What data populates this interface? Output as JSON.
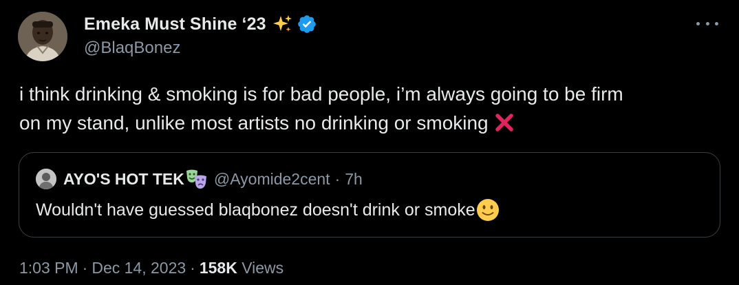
{
  "author": {
    "name": "Emeka Must Shine ‘23",
    "handle": "@BlaqBonez",
    "badge_color": "#1d9bf0"
  },
  "tweet": {
    "line1": "i think drinking & smoking is for bad people, i’m always going to be firm",
    "line2": "on my stand, unlike most artists no drinking or smoking"
  },
  "quote": {
    "name": "AYO'S HOT TEK",
    "handle": "@Ayomide2cent",
    "separator": "·",
    "time": "7h",
    "text": "Wouldn't have guessed blaqbonez doesn't drink or smoke"
  },
  "meta": {
    "time": "1:03 PM",
    "dot1": "·",
    "date": "Dec 14, 2023",
    "dot2": "·",
    "views_count": "158K",
    "views_label": "Views"
  },
  "icons": {
    "author_name_emoji": "sparkles-icon",
    "verified": "verified-badge-icon",
    "tweet_end_emoji": "cross-mark-icon",
    "quote_name_emoji": "performing-arts-masks-icon",
    "quote_text_emoji": "slightly-smiling-face-icon",
    "more": "more-horizontal-icon"
  },
  "colors": {
    "background": "#000000",
    "text_primary": "#e7e9ea",
    "text_secondary": "#8b98a5",
    "border": "#3a3f44",
    "accent": "#1d9bf0",
    "cross": "#e0245e"
  }
}
